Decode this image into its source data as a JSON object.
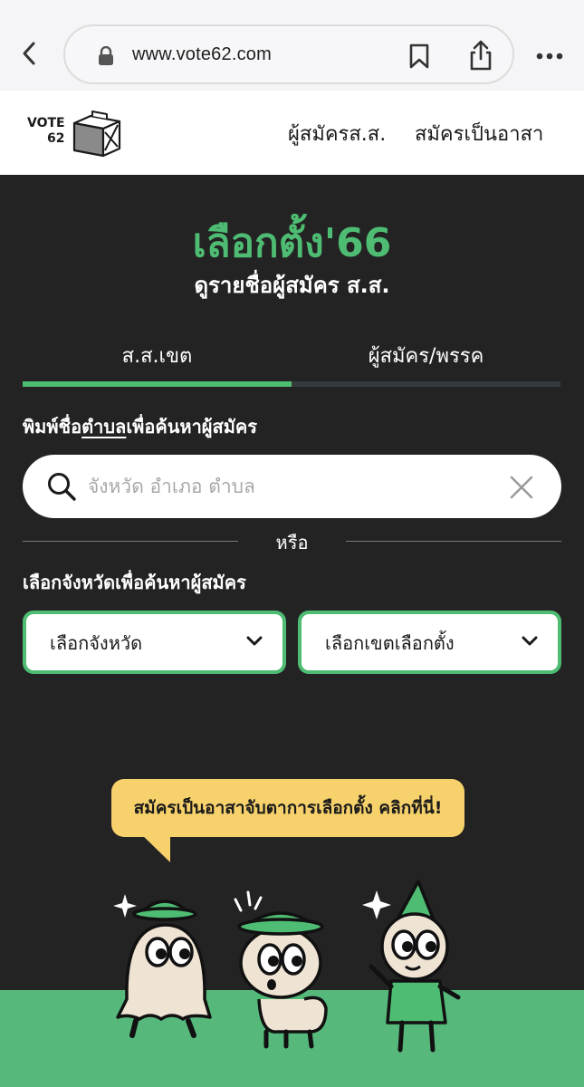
{
  "browser": {
    "url": "www.vote62.com"
  },
  "header": {
    "logo_line1": "VOTE",
    "logo_line2": "62",
    "nav": [
      {
        "label": "ผู้สมัครส.ส."
      },
      {
        "label": "สมัครเป็นอาสา"
      }
    ]
  },
  "hero": {
    "title": "เลือกตั้ง'66",
    "subtitle": "ดูรายชื่อผู้สมัคร ส.ส."
  },
  "tabs": [
    {
      "label": "ส.ส.เขต",
      "active": true
    },
    {
      "label": "ผู้สมัคร/พรรค",
      "active": false
    }
  ],
  "search": {
    "label_prefix": "พิมพ์ชื่อ",
    "label_underlined": "ตำบล",
    "label_suffix": "เพื่อค้นหาผู้สมัคร",
    "placeholder": "จังหวัด อำเภอ ตำบล",
    "value": ""
  },
  "divider_text": "หรือ",
  "province_section": {
    "label": "เลือกจังหวัดเพื่อค้นหาผู้สมัคร",
    "province_dropdown": "เลือกจังหวัด",
    "district_dropdown": "เลือกเขตเลือกตั้ง"
  },
  "promo": {
    "bubble_text": "สมัครเป็นอาสาจับตาการเลือกตั้ง คลิกที่นี่!"
  },
  "colors": {
    "accent_green": "#4ebc72",
    "dark_bg": "#232323",
    "bubble_yellow": "#f7d16b",
    "ground_green": "#56b97b"
  },
  "icons": [
    "back-icon",
    "lock-icon",
    "bookmark-icon",
    "share-icon",
    "more-icon",
    "search-icon",
    "clear-icon",
    "chevron-down-icon"
  ]
}
